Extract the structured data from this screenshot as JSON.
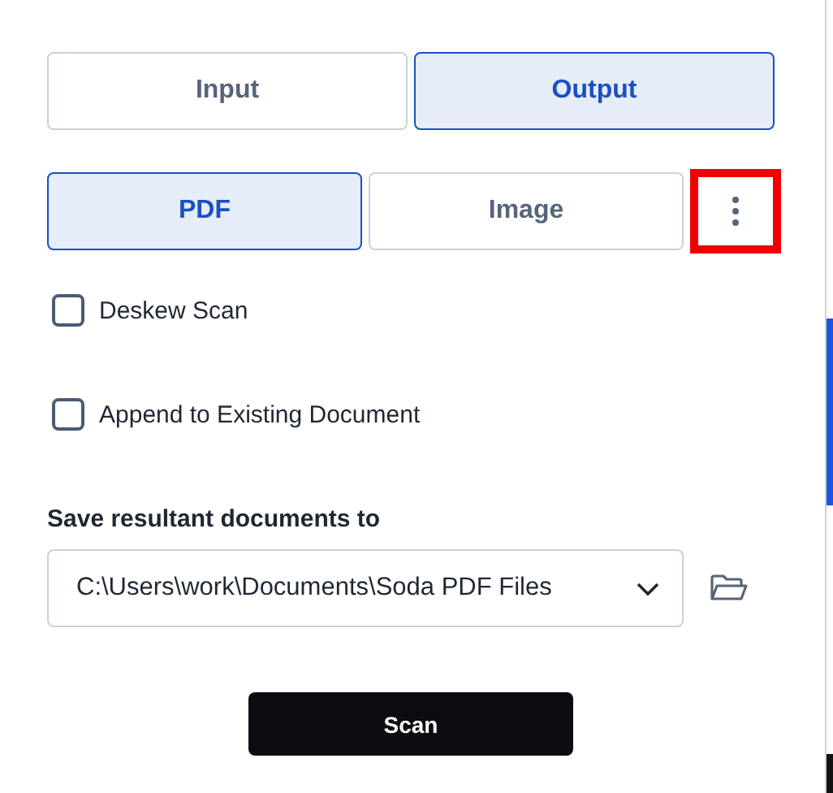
{
  "direction_tabs": [
    {
      "label": "Input",
      "selected": false
    },
    {
      "label": "Output",
      "selected": true
    }
  ],
  "format_tabs": [
    {
      "label": "PDF",
      "selected": true
    },
    {
      "label": "Image",
      "selected": false
    }
  ],
  "more_button": {
    "highlighted": true
  },
  "options": [
    {
      "label": "Deskew Scan",
      "checked": false
    },
    {
      "label": "Append to Existing Document",
      "checked": false
    }
  ],
  "save_location": {
    "label": "Save resultant documents to",
    "value": "C:\\Users\\work\\Documents\\Soda PDF Files"
  },
  "scan_button": {
    "label": "Scan"
  }
}
